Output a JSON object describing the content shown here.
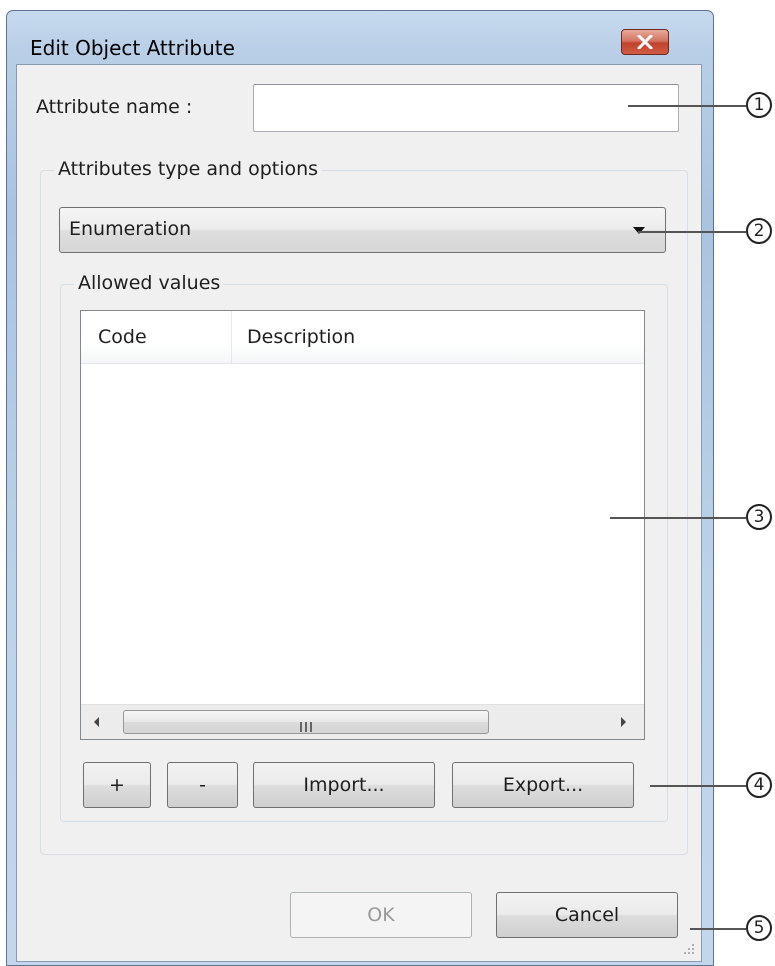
{
  "window": {
    "title": "Edit Object Attribute",
    "close_label": "close"
  },
  "form": {
    "attribute_name_label": "Attribute name :",
    "attribute_name_value": "",
    "type_group_title": "Attributes type and options",
    "type_selected": "Enumeration",
    "allowed_group_title": "Allowed values",
    "columns": [
      "Code",
      "Description"
    ],
    "rows": []
  },
  "scrollbar": {
    "grip_glyph": "III"
  },
  "buttons": {
    "add": "+",
    "remove": "-",
    "import": "Import...",
    "export": "Export...",
    "ok": "OK",
    "cancel": "Cancel"
  },
  "callouts": [
    "1",
    "2",
    "3",
    "4",
    "5"
  ],
  "colors": {
    "close_button": "#c1422c",
    "frame": "#b9cfe7",
    "client": "#f0f0f0"
  }
}
